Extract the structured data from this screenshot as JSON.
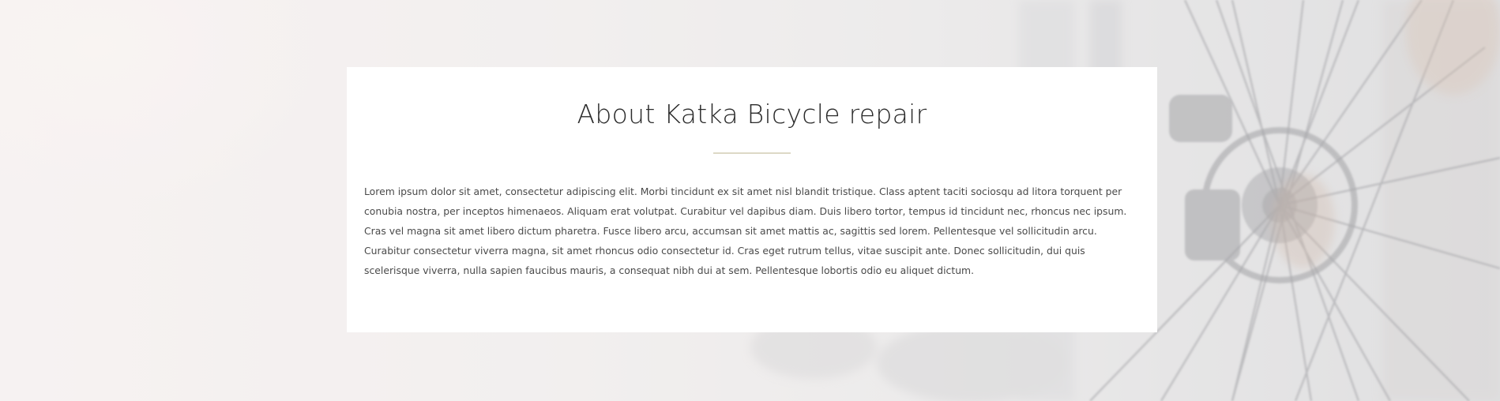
{
  "about": {
    "title": "About Katka Bicycle repair",
    "body": "Lorem ipsum dolor sit amet, consectetur adipiscing elit. Morbi tincidunt ex sit amet nisl blandit tristique. Class aptent taciti sociosqu ad litora torquent per conubia nostra, per inceptos himenaeos. Aliquam erat volutpat. Curabitur vel dapibus diam. Duis libero tortor, tempus id tincidunt nec, rhoncus nec ipsum. Cras vel magna sit amet libero dictum pharetra. Fusce libero arcu, accumsan sit amet mattis ac, sagittis sed lorem. Pellentesque vel sollicitudin arcu. Curabitur consectetur viverra magna, sit amet rhoncus odio consectetur id. Cras eget rutrum tellus, vitae suscipit ante. Donec sollicitudin, dui quis scelerisque viverra, nulla sapien faucibus mauris, a consequat nibh dui at sem. Pellentesque lobortis odio eu aliquet dictum."
  },
  "colors": {
    "card_background": "#ffffff",
    "title_text": "#2b2b2b",
    "body_text": "#4a4a4a",
    "divider_accent": "#ddd9c6"
  }
}
